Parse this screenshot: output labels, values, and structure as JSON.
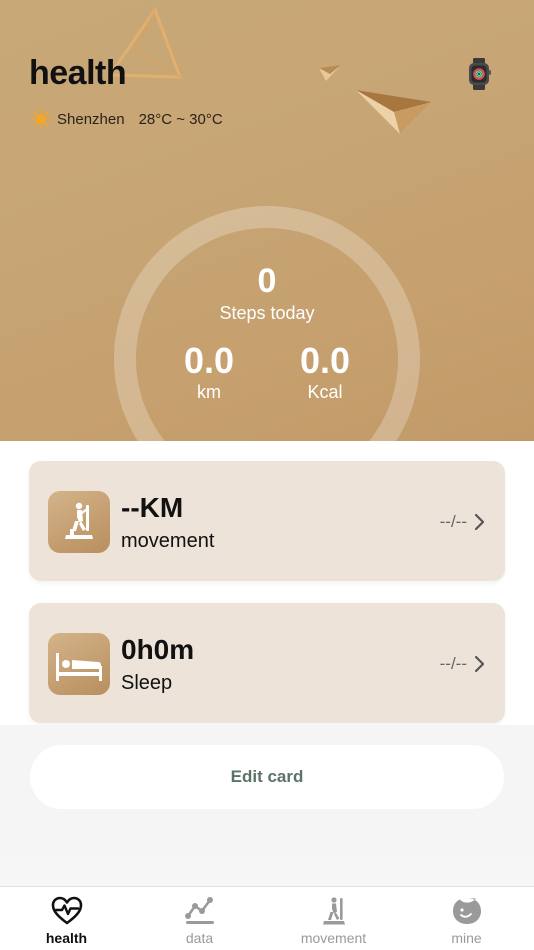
{
  "header": {
    "title": "health",
    "city": "Shenzhen",
    "temperature": "28°C ~ 30°C"
  },
  "summary": {
    "steps": "0",
    "steps_label": "Steps today",
    "distance": "0.0",
    "distance_unit": "km",
    "calories": "0.0",
    "calories_unit": "Kcal"
  },
  "cards": [
    {
      "title": "--KM",
      "subtitle": "movement",
      "date": "--/--",
      "icon": "elliptical-trainer-icon"
    },
    {
      "title": "0h0m",
      "subtitle": "Sleep",
      "date": "--/--",
      "icon": "bed-icon"
    }
  ],
  "edit_label": "Edit card",
  "tabs": [
    {
      "label": "health",
      "icon": "heart-pulse-icon",
      "active": true
    },
    {
      "label": "data",
      "icon": "chart-line-icon",
      "active": false
    },
    {
      "label": "movement",
      "icon": "elliptical-trainer-icon",
      "active": false
    },
    {
      "label": "mine",
      "icon": "face-icon",
      "active": false
    }
  ],
  "colors": {
    "hero": "#c7a575",
    "card": "#ede3d9",
    "edit_text": "#5c7468",
    "tab_inactive": "#9a9a9a"
  }
}
